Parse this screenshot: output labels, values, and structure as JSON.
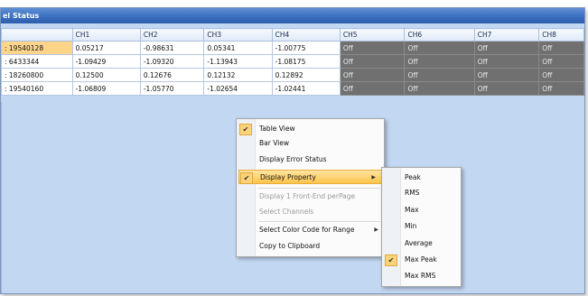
{
  "window": {
    "title": "el Status"
  },
  "grid": {
    "columns": [
      "",
      "CH1",
      "CH2",
      "CH3",
      "CH4",
      "CH5",
      "CH6",
      "CH7",
      "CH8"
    ],
    "rows": [
      {
        "id": ": 19540128",
        "cells": [
          "0.05217",
          "-0.98631",
          "0.05341",
          "-1.00775",
          "Off",
          "Off",
          "Off",
          "Off"
        ]
      },
      {
        "id": ": 6433344",
        "cells": [
          "-1.09429",
          "-1.09320",
          "-1.13943",
          "-1.08175",
          "Off",
          "Off",
          "Off",
          "Off"
        ]
      },
      {
        "id": ": 18260800",
        "cells": [
          "0.12500",
          "0.12676",
          "0.12132",
          "0.12892",
          "Off",
          "Off",
          "Off",
          "Off"
        ]
      },
      {
        "id": ": 19540160",
        "cells": [
          "-1.06809",
          "-1.05770",
          "-1.02654",
          "-1.02441",
          "Off",
          "Off",
          "Off",
          "Off"
        ]
      }
    ]
  },
  "context_menu": {
    "items": [
      {
        "label": "Table View",
        "checked": true
      },
      {
        "label": "Bar View"
      },
      {
        "label": "Display Error Status"
      },
      {
        "label": "Display Property",
        "checked": true,
        "highlighted": true,
        "submenu": true
      },
      {
        "label": "Display 1 Front-End perPage",
        "disabled": true
      },
      {
        "label": "Select Channels",
        "disabled": true
      },
      {
        "label": "Select Color Code for Range",
        "submenu": true
      },
      {
        "label": "Copy to Clipboard"
      }
    ]
  },
  "submenu": {
    "items": [
      {
        "label": "Peak"
      },
      {
        "label": "RMS"
      },
      {
        "label": "Max"
      },
      {
        "label": "Min"
      },
      {
        "label": "Average"
      },
      {
        "label": "Max Peak",
        "checked": true
      },
      {
        "label": "Max RMS"
      }
    ]
  },
  "colors": {
    "title_bar": "#3b6fc0",
    "off_cell": "#707070",
    "highlight": "#fcc44c",
    "background": "#c2d8f2"
  }
}
